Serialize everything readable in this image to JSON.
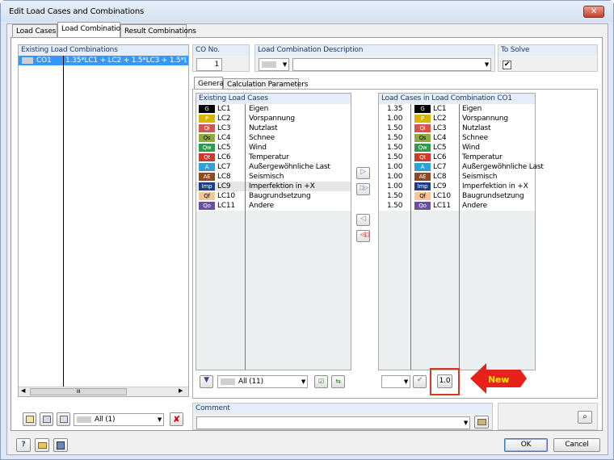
{
  "window": {
    "title": "Edit Load Cases and Combinations",
    "close_glyph": "✕"
  },
  "tabs": [
    "Load Cases",
    "Load Combinations",
    "Result Combinations"
  ],
  "existing_combos": {
    "header": "Existing Load Combinations",
    "rows": [
      {
        "id": "CO1",
        "formula": "1.35*LC1 + LC2 + 1.5*LC3 + 1.5*LC4 +"
      }
    ],
    "filter": "All (1)",
    "scroll_grip": "III"
  },
  "co": {
    "no_label": "CO No.",
    "no_value": "1",
    "desc_label": "Load Combination Description",
    "desc_value": "",
    "solve_label": "To Solve",
    "solve_checked": true
  },
  "subtabs": [
    "General",
    "Calculation Parameters"
  ],
  "existing_cases": {
    "header": "Existing Load Cases",
    "filter": "All (11)"
  },
  "in_combo": {
    "header": "Load Cases in Load Combination CO1",
    "factor_button": "1.0",
    "new_callout": "New"
  },
  "load_cases": [
    {
      "tag": "G",
      "bg": "#000000",
      "fg": "#ffffff",
      "id": "LC1",
      "name": "Eigen",
      "factor": "1.35"
    },
    {
      "tag": "P",
      "bg": "#d9b400",
      "fg": "#ffffff",
      "id": "LC2",
      "name": "Vorspannung",
      "factor": "1.00"
    },
    {
      "tag": "Qi",
      "bg": "#d9534a",
      "fg": "#ffffff",
      "id": "LC3",
      "name": "Nutzlast",
      "factor": "1.50"
    },
    {
      "tag": "Qs",
      "bg": "#8faa3c",
      "fg": "#000000",
      "id": "LC4",
      "name": "Schnee",
      "factor": "1.50"
    },
    {
      "tag": "Qw",
      "bg": "#2e9a4c",
      "fg": "#ffffff",
      "id": "LC5",
      "name": "Wind",
      "factor": "1.50"
    },
    {
      "tag": "Qt",
      "bg": "#cc3a2a",
      "fg": "#ffffff",
      "id": "LC6",
      "name": "Temperatur",
      "factor": "1.50"
    },
    {
      "tag": "A",
      "bg": "#2ea1d6",
      "fg": "#ffffff",
      "id": "LC7",
      "name": "Außergewöhnliche Last",
      "factor": "1.00"
    },
    {
      "tag": "AE",
      "bg": "#8b4a25",
      "fg": "#ffffff",
      "id": "LC8",
      "name": "Seismisch",
      "factor": "1.00"
    },
    {
      "tag": "Imp",
      "bg": "#1c3e8a",
      "fg": "#ffffff",
      "id": "LC9",
      "name": "Imperfektion in +X",
      "factor": "1.00"
    },
    {
      "tag": "Qf",
      "bg": "#f5c499",
      "fg": "#000000",
      "id": "LC10",
      "name": "Baugrundsetzung",
      "factor": "1.50"
    },
    {
      "tag": "Qo",
      "bg": "#6b4ea0",
      "fg": "#ffffff",
      "id": "LC11",
      "name": "Andere",
      "factor": "1.50"
    }
  ],
  "comment": {
    "label": "Comment",
    "value": ""
  },
  "footer": {
    "ok": "OK",
    "cancel": "Cancel"
  },
  "glyphs": {
    "add": "▷",
    "add_all": "▷▷",
    "remove": "◁",
    "remove_all": "◁◁",
    "dropdown": "▼",
    "check": "✔"
  }
}
